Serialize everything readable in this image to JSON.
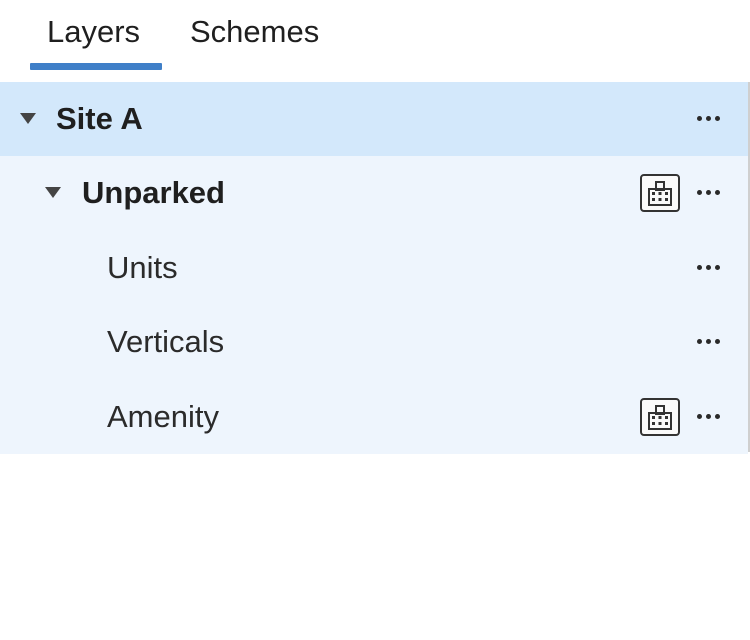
{
  "tabs": {
    "layers": "Layers",
    "schemes": "Schemes",
    "active": "Layers"
  },
  "colors": {
    "accent": "#3f7fc8",
    "root_row_bg": "#d3e8fb",
    "child_row_bg": "#eef5fd"
  },
  "tree": {
    "root": {
      "label": "Site A",
      "expanded": true,
      "icon": "caret-down-icon",
      "menu_icon": "more-horizontal-icon"
    },
    "group": {
      "label": "Unparked",
      "expanded": true,
      "icon": "caret-down-icon",
      "badge_icon": "building-icon",
      "menu_icon": "more-horizontal-icon"
    },
    "items": [
      {
        "label": "Units",
        "badge_icon": "",
        "menu_icon": "more-horizontal-icon"
      },
      {
        "label": "Verticals",
        "badge_icon": "",
        "menu_icon": "more-horizontal-icon"
      },
      {
        "label": "Amenity",
        "badge_icon": "building-icon",
        "menu_icon": "more-horizontal-icon"
      }
    ]
  }
}
